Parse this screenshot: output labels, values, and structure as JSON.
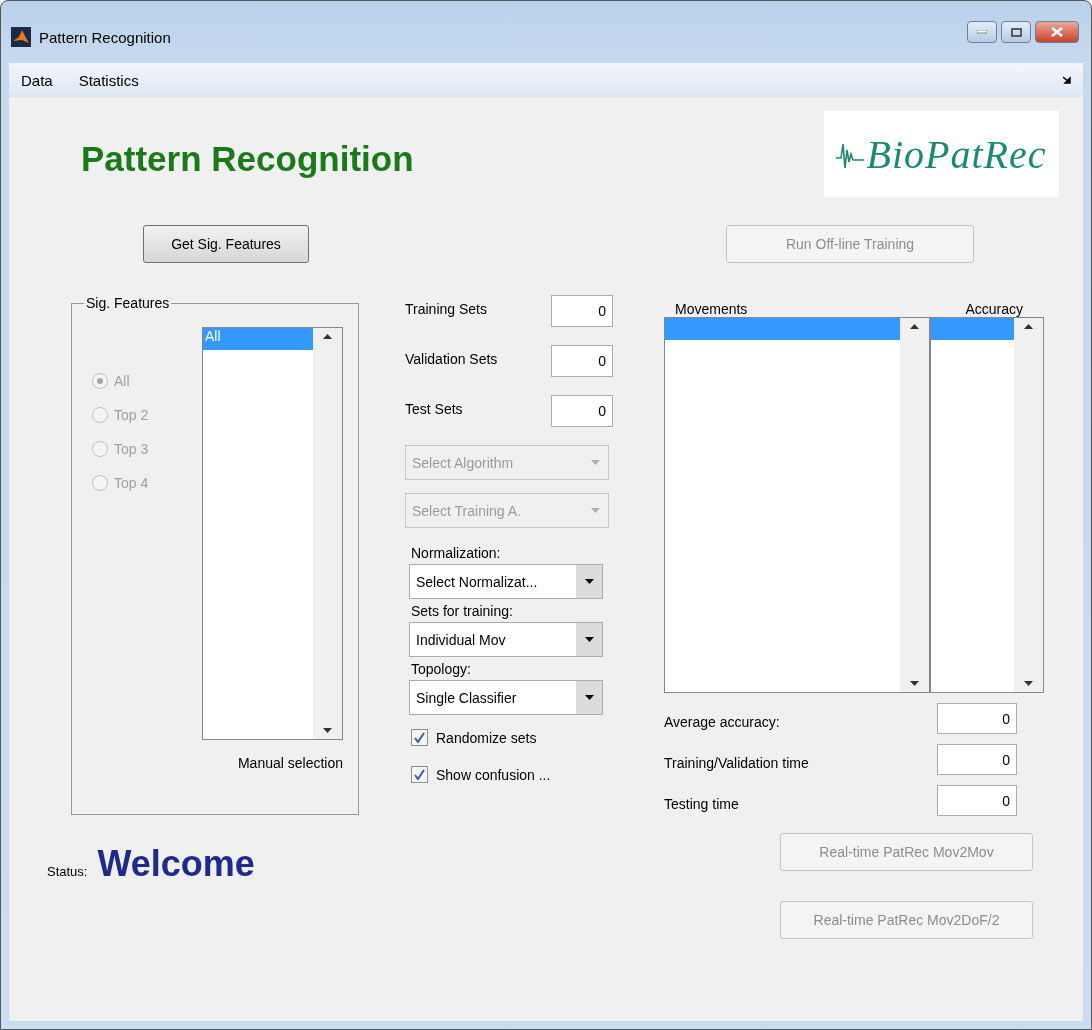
{
  "window": {
    "title": "Pattern Recognition"
  },
  "menu": [
    {
      "label": "Data"
    },
    {
      "label": "Statistics"
    }
  ],
  "heading": "Pattern Recognition",
  "logo": "BioPatRec",
  "get_features_button": {
    "label": "Get Sig. Features",
    "disabled": false
  },
  "train_button": {
    "label": "Run Off-line Training",
    "disabled": true
  },
  "features_group": {
    "title": "Sig. Features",
    "disabled": true,
    "options": [
      {
        "label": "All",
        "selected": true
      },
      {
        "label": "Top 2",
        "selected": false
      },
      {
        "label": "Top 3",
        "selected": false
      },
      {
        "label": "Top 4",
        "selected": false
      }
    ],
    "list": [
      {
        "label": "All",
        "selected": true
      }
    ],
    "caption": "Manual selection"
  },
  "sets": [
    {
      "label": "Training Sets",
      "value": "0"
    },
    {
      "label": "Validation Sets",
      "value": "0"
    },
    {
      "label": "Test Sets",
      "value": "0"
    }
  ],
  "dropdowns": [
    {
      "value": "Select Algorithm",
      "disabled": true
    },
    {
      "value": "Select Training A.",
      "disabled": true
    },
    {
      "label": "Normalization:",
      "value": "Select Normalizat...",
      "disabled": false
    },
    {
      "label": "Sets for training:",
      "value": "Individual Mov",
      "disabled": false
    },
    {
      "label": "Topology:",
      "value": "Single Classifier",
      "disabled": false
    }
  ],
  "checkboxes": [
    {
      "label": "Randomize sets",
      "checked": true
    },
    {
      "label": "Show confusion ...",
      "checked": true
    }
  ],
  "results": {
    "movements_header": "Movements",
    "accuracy_header": "Accuracy",
    "movements": [
      {
        "selected": true
      }
    ],
    "accuracy": [
      {
        "selected": true
      }
    ]
  },
  "metrics": [
    {
      "label": "Average accuracy:",
      "value": "0"
    },
    {
      "label": "Training/Validation time",
      "value": "0"
    },
    {
      "label": "Testing time",
      "value": "0"
    }
  ],
  "status": {
    "label": "Status:",
    "message": "Welcome"
  },
  "realtime_buttons": [
    {
      "label": "Real-time PatRec Mov2Mov",
      "disabled": true
    },
    {
      "label": "Real-time PatRec Mov2DoF/2",
      "disabled": true
    }
  ]
}
